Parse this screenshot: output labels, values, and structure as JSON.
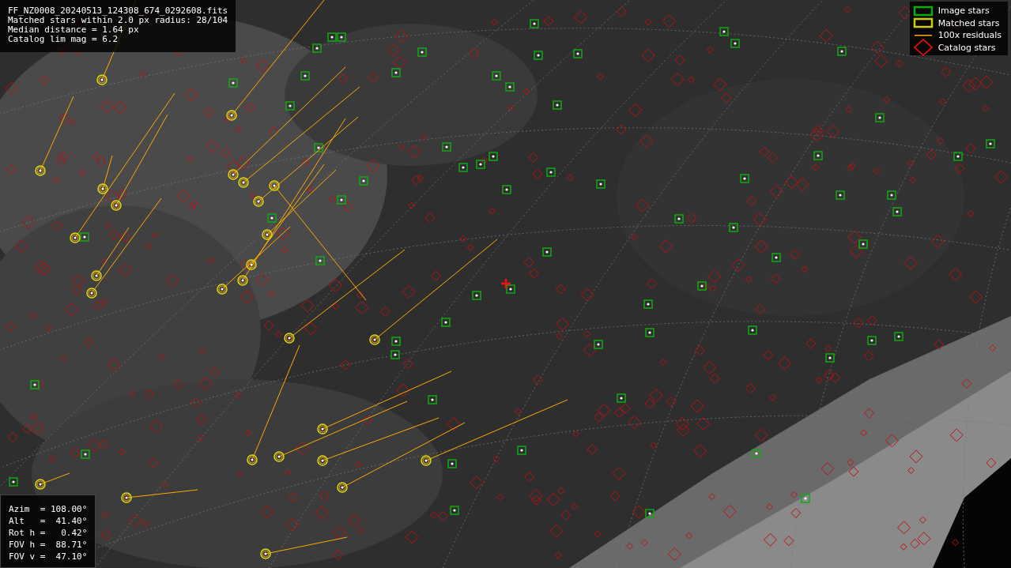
{
  "info": {
    "lines": [
      "FF_NZ0008_20240513_124308_674_0292608.fits",
      "Matched stars within 2.0 px radius: 28/104",
      "Median distance = 1.64 px",
      "Catalog lim mag = 6.2"
    ]
  },
  "legend": [
    {
      "kind": "image",
      "label": "Image stars",
      "color": "#11aa11"
    },
    {
      "kind": "matched",
      "label": "Matched stars",
      "color": "#cccc11"
    },
    {
      "kind": "residual",
      "label": "100x residuals",
      "color": "#ffaa00"
    },
    {
      "kind": "catalog",
      "label": "Catalog stars",
      "color": "#cc1111"
    }
  ],
  "pointing": {
    "lines": [
      "Azim  = 108.00°",
      "Alt   =  41.40°",
      "Rot h =   0.42°",
      "FOV h =  88.71°",
      "FOV v =  47.10°"
    ]
  }
}
